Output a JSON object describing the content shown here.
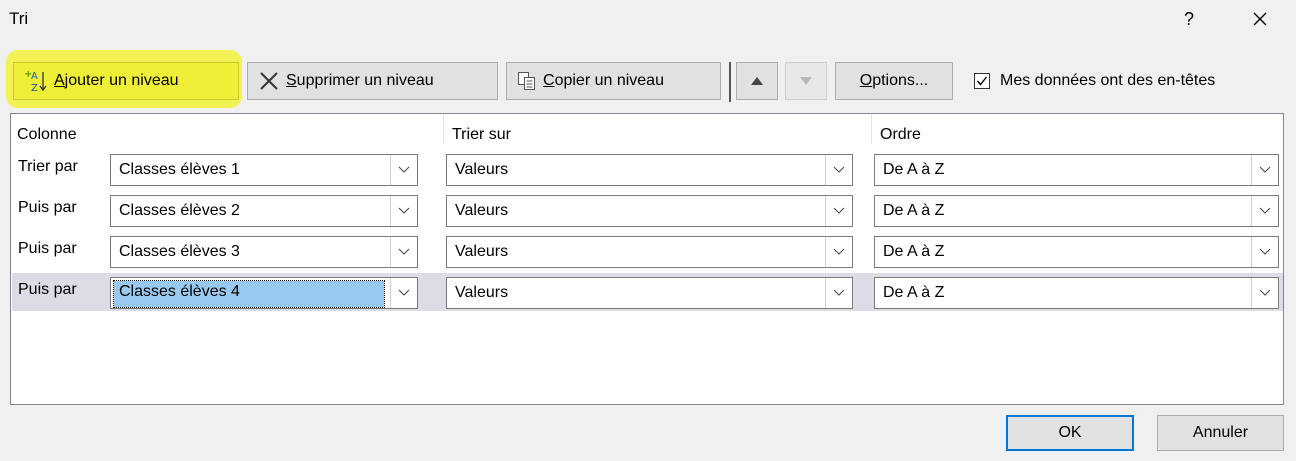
{
  "window": {
    "title": "Tri",
    "help_label": "?",
    "close_icon": "close-icon"
  },
  "toolbar": {
    "add_label": "Ajouter un niveau",
    "delete_label": "Supprimer un niveau",
    "copy_label": "Copier un niveau",
    "options_label": "Options...",
    "headers_label": "Mes données ont des en-têtes",
    "headers_checked": true
  },
  "columns": {
    "col1": "Colonne",
    "col2": "Trier sur",
    "col3": "Ordre"
  },
  "rows": [
    {
      "label": "Trier par",
      "column": "Classes élèves 1",
      "sort_on": "Valeurs",
      "order": "De A à Z"
    },
    {
      "label": "Puis par",
      "column": "Classes élèves 2",
      "sort_on": "Valeurs",
      "order": "De A à Z"
    },
    {
      "label": "Puis par",
      "column": "Classes élèves 3",
      "sort_on": "Valeurs",
      "order": "De A à Z"
    },
    {
      "label": "Puis par",
      "column": "Classes élèves 4",
      "sort_on": "Valeurs",
      "order": "De A à Z"
    }
  ],
  "footer": {
    "ok_label": "OK",
    "cancel_label": "Annuler"
  },
  "colors": {
    "highlight": "#f2f23a",
    "selection": "#99c9ef",
    "ok_border": "#0078d7"
  }
}
